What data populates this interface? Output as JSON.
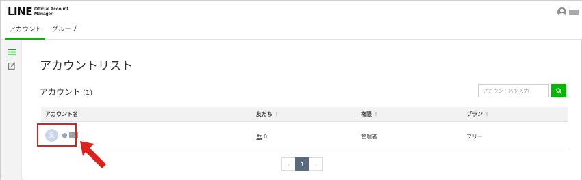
{
  "header": {
    "logo_mark": "LINE",
    "logo_sub": "Official Account Manager"
  },
  "tabs": [
    {
      "label": "アカウント",
      "active": true
    },
    {
      "label": "グループ",
      "active": false
    }
  ],
  "sidebar": {
    "icons": [
      "list-icon",
      "edit-icon"
    ]
  },
  "main": {
    "page_title": "アカウントリスト",
    "section_title": "アカウント",
    "section_count": "(1)",
    "search": {
      "placeholder": "アカウント名を入力"
    },
    "table": {
      "headers": [
        "アカウント名",
        "友だち",
        "権限",
        "プラン"
      ],
      "sort_icon": "⇕",
      "rows": [
        {
          "friends": "0",
          "role": "管理者",
          "plan": "フリー"
        }
      ]
    },
    "pagination": {
      "prev": "‹",
      "current": "1",
      "next": "›"
    }
  },
  "colors": {
    "accent": "#00b900",
    "highlight": "#e0201b",
    "page_active": "#5b6b7f"
  }
}
